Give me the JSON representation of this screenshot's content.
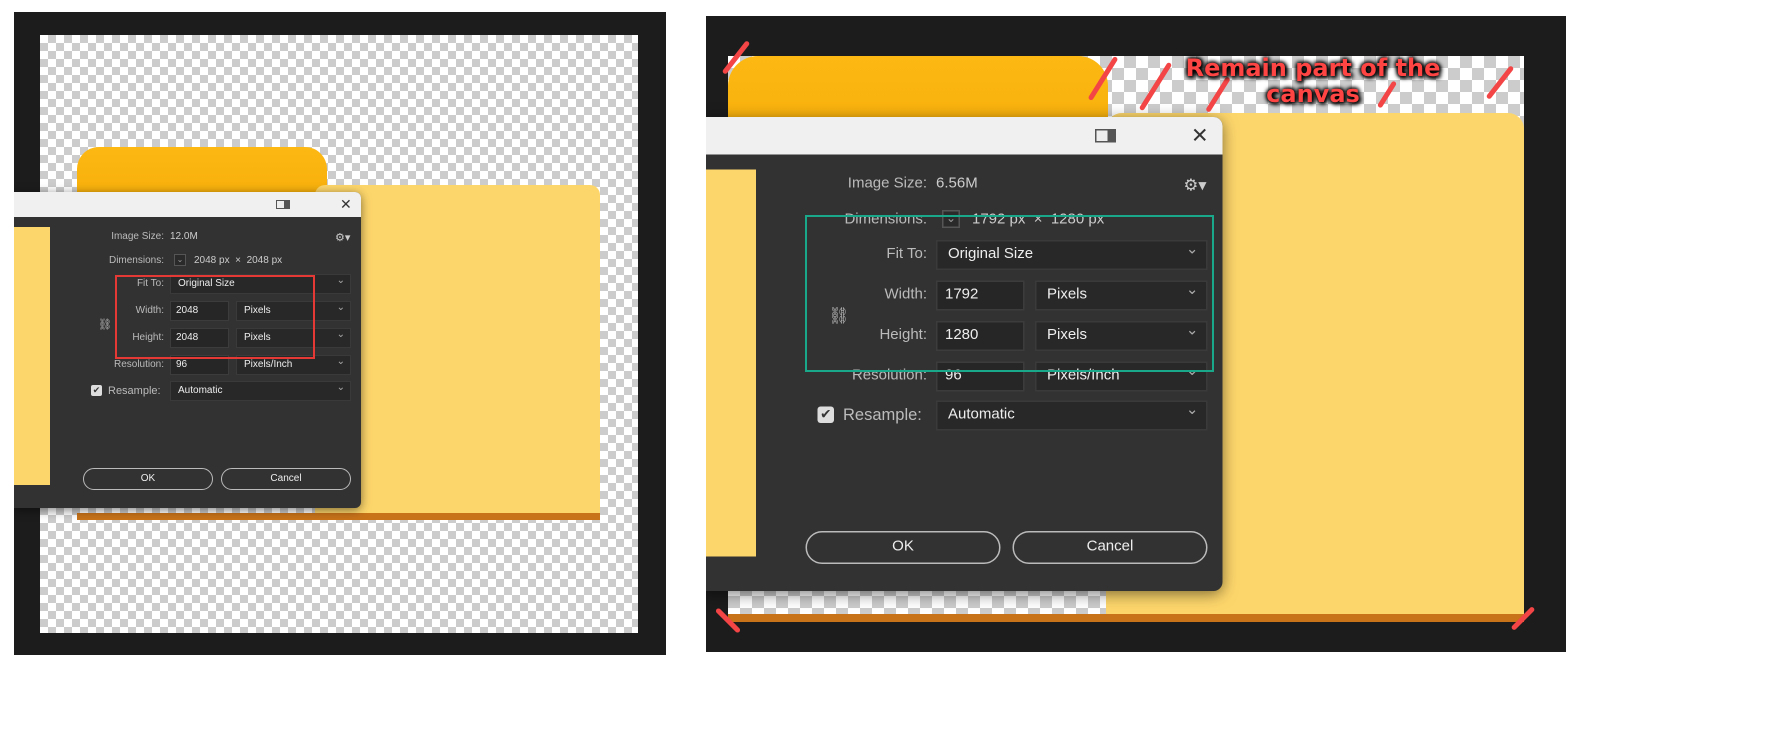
{
  "left_dialog": {
    "image_size_label": "Image Size:",
    "image_size": "12.0M",
    "dimensions_label": "Dimensions:",
    "dim_w": "2048 px",
    "times": "×",
    "dim_h": "2048 px",
    "fit_to_label": "Fit To:",
    "fit_to": "Original Size",
    "width_label": "Width:",
    "width": "2048",
    "width_unit": "Pixels",
    "height_label": "Height:",
    "height": "2048",
    "height_unit": "Pixels",
    "resolution_label": "Resolution:",
    "resolution": "96",
    "resolution_unit": "Pixels/Inch",
    "resample_label": "Resample:",
    "resample": "Automatic",
    "resample_checked": true,
    "ok": "OK",
    "cancel": "Cancel"
  },
  "right_dialog": {
    "image_size_label": "Image Size:",
    "image_size": "6.56M",
    "dimensions_label": "Dimensions:",
    "dim_w": "1792 px",
    "times": "×",
    "dim_h": "1280 px",
    "fit_to_label": "Fit To:",
    "fit_to": "Original Size",
    "width_label": "Width:",
    "width": "1792",
    "width_unit": "Pixels",
    "height_label": "Height:",
    "height": "1280",
    "height_unit": "Pixels",
    "resolution_label": "Resolution:",
    "resolution": "96",
    "resolution_unit": "Pixels/Inch",
    "resample_label": "Resample:",
    "resample": "Automatic",
    "resample_checked": true,
    "ok": "OK",
    "cancel": "Cancel"
  },
  "annotation": {
    "line1": "Remain part of the",
    "line2": "canvas"
  },
  "colors": {
    "highlight_left": "#e53935",
    "highlight_right": "#1aa88a",
    "dash": "#f34545"
  }
}
